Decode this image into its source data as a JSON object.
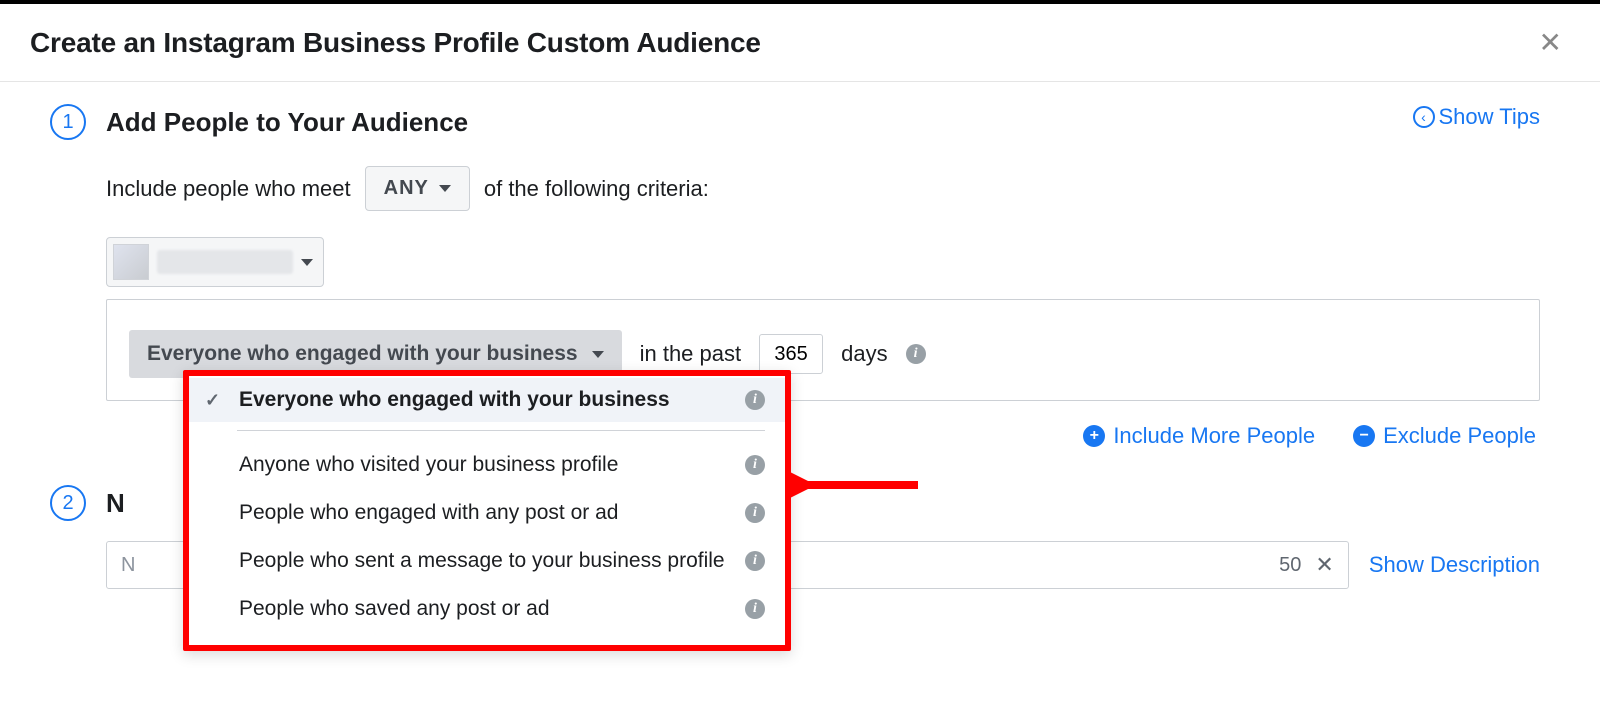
{
  "header": {
    "title": "Create an Instagram Business Profile Custom Audience"
  },
  "show_tips": "Show Tips",
  "step1": {
    "number": "1",
    "title": "Add People to Your Audience",
    "criteria_prefix": "Include people who meet",
    "criteria_selector": "ANY",
    "criteria_suffix": "of the following criteria:",
    "engagement_selector": "Everyone who engaged with your business",
    "days_prefix": "in the past",
    "days_value": "365",
    "days_suffix": "days",
    "include_more": "Include More People",
    "exclude": "Exclude People"
  },
  "dropdown": {
    "options": [
      "Everyone who engaged with your business",
      "Anyone who visited your business profile",
      "People who engaged with any post or ad",
      "People who sent a message to your business profile",
      "People who saved any post or ad"
    ]
  },
  "step2": {
    "number": "2",
    "title_initial": "N",
    "name_placeholder": "N",
    "char_limit": "50",
    "show_description": "Show Description"
  }
}
